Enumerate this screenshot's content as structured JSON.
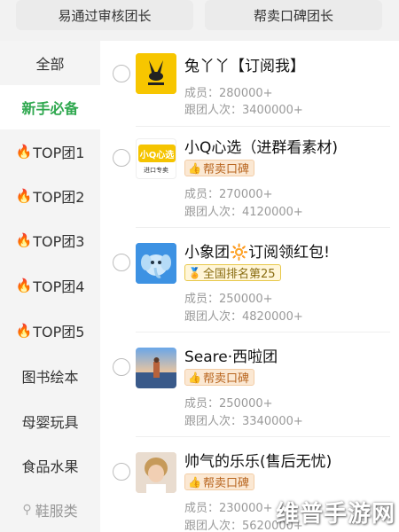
{
  "topbar": {
    "btn_left": "易通过审核团长",
    "btn_right": "帮卖口碑团长"
  },
  "sidebar": {
    "items": [
      {
        "label": "全部",
        "fire": false
      },
      {
        "label": "新手必备",
        "fire": false,
        "active": true
      },
      {
        "label": "TOP团1",
        "fire": true
      },
      {
        "label": "TOP团2",
        "fire": true
      },
      {
        "label": "TOP团3",
        "fire": true
      },
      {
        "label": "TOP团4",
        "fire": true
      },
      {
        "label": "TOP团5",
        "fire": true
      },
      {
        "label": "图书绘本",
        "fire": false
      },
      {
        "label": "母婴玩具",
        "fire": false
      },
      {
        "label": "食品水果",
        "fire": false
      },
      {
        "label": "鞋服类",
        "fire": false
      }
    ],
    "active_color": "#2fa84f",
    "fire_color": "#ff6a00"
  },
  "groups": [
    {
      "title": "兔丫丫【订阅我】",
      "badge": "",
      "members_label": "成员：",
      "members": "280000+",
      "followers_label": "跟团人次：",
      "followers": "3400000+"
    },
    {
      "title": "小Q心选（进群看素材)",
      "badge": "帮卖口碑",
      "members_label": "成员：",
      "members": "270000+",
      "followers_label": "跟团人次：",
      "followers": "4120000+"
    },
    {
      "title": "小象团🔆订阅领红包!",
      "badge": "全国排名第25",
      "members_label": "成员：",
      "members": "250000+",
      "followers_label": "跟团人次：",
      "followers": "4820000+"
    },
    {
      "title": "Seare·西啦团",
      "badge": "帮卖口碑",
      "members_label": "成员：",
      "members": "250000+",
      "followers_label": "跟团人次：",
      "followers": "3340000+"
    },
    {
      "title": "帅气的乐乐(售后无忧)",
      "badge": "帮卖口碑",
      "members_label": "成员：",
      "members": "230000+",
      "followers_label": "跟团人次：",
      "followers": "5620000+"
    }
  ],
  "thumb_texts": {
    "xiaoq": "小Q心选",
    "xiaoq_sub": "进口专卖"
  },
  "watermark": "维普手游网"
}
